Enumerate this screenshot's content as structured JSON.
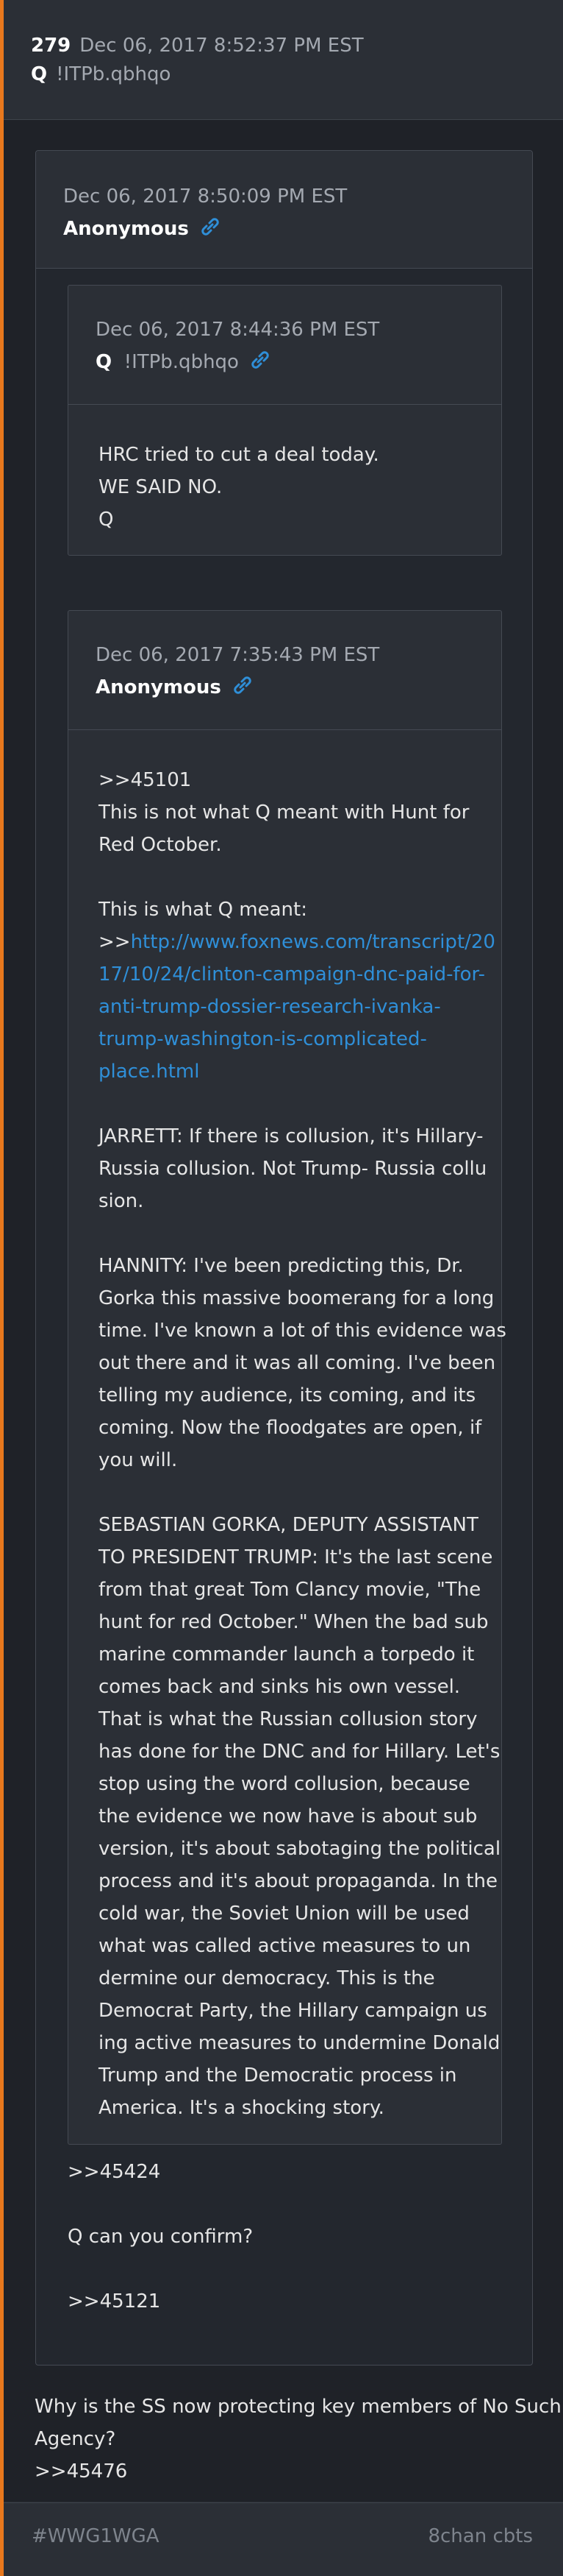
{
  "header": {
    "post_number": "279",
    "datetime": "Dec 06, 2017 8:52:37 PM EST",
    "name": "Q",
    "tripcode": "!ITPb.qbhqo"
  },
  "card": {
    "datetime": "Dec 06, 2017 8:50:09 PM EST",
    "name": "Anonymous",
    "quote1": {
      "datetime": "Dec 06, 2017 8:44:36 PM EST",
      "name": "Q",
      "tripcode": "!ITPb.qbhqo",
      "lines": [
        "HRC tried to cut a deal today.",
        "WE SAID NO.",
        "Q"
      ]
    },
    "quote2": {
      "datetime": "Dec 06, 2017 7:35:43 PM EST",
      "name": "Anonymous",
      "p1": [
        "&gt;&gt;45101",
        "This is not what Q meant with Hunt for",
        "Red October."
      ],
      "p2_intro": "This is what Q meant:",
      "p2_prefix": ">>",
      "link_lines": [
        "http://www.foxnews.com/transcript/20",
        "17/10/24/clinton-campaign-dnc-paid-for-",
        "anti-trump-dossier-research-ivanka-",
        "trump-washington-is-complicated-",
        "place.html"
      ],
      "p3": [
        "JARRETT: If there is collusion, it's Hillary-",
        "Russia collusion. Not Trump- Russia collu",
        "sion."
      ],
      "p4": [
        "HANNITY: I've been predicting this, Dr.",
        "Gorka this massive boomerang for a long",
        "time. I've known a lot of this evidence was",
        "out there and it was all coming. I've been",
        "telling my audience, its coming, and its",
        "coming. Now the floodgates are open, if",
        "you will."
      ],
      "p5": [
        "SEBASTIAN GORKA, DEPUTY ASSISTANT",
        "TO PRESIDENT TRUMP: It's the last scene",
        "from that great Tom Clancy movie, \"The",
        "hunt for red October.\" When the bad sub",
        "marine commander launch a torpedo it",
        "comes back and sinks his own vessel.",
        "That is what the Russian collusion story",
        "has done for the DNC and for Hillary. Let's",
        "stop using the word collusion, because",
        "the evidence we now have is about sub",
        "version, it's about sabotaging the political",
        "process and it's about propaganda. In the",
        "cold war, the Soviet Union will be used",
        "what was called active measures to un",
        "dermine our democracy. This is the",
        "Democrat Party, the Hillary campaign us",
        "ing active measures to undermine Donald",
        "Trump and the Democratic process in",
        "America. It's a shocking story."
      ]
    },
    "footer_lines": [
      ">>45424",
      "Q can you confirm?",
      ">>45121"
    ]
  },
  "post_text": [
    "Why is the SS now protecting key members of No Such",
    "Agency?",
    ">>45476"
  ],
  "footer": {
    "hashtag": "#WWG1WGA",
    "source": "8chan cbts"
  },
  "colors": {
    "accent_left_bar": "#e8781d",
    "link": "#2f8fd8"
  },
  "icons": [
    "link-icon"
  ]
}
